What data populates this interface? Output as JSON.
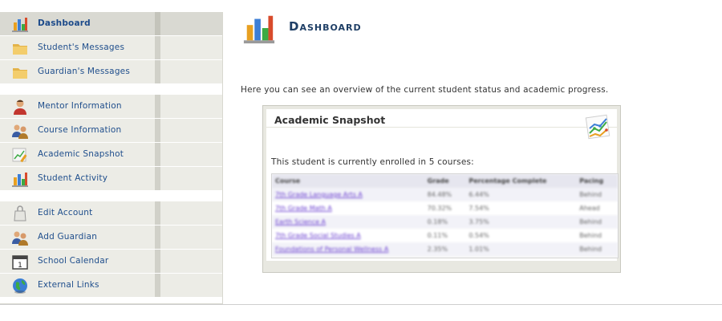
{
  "sidebar": {
    "groups": [
      [
        {
          "label": "Dashboard",
          "icon": "bar-chart-icon",
          "active": true
        },
        {
          "label": "Student's Messages",
          "icon": "folder-icon"
        },
        {
          "label": "Guardian's Messages",
          "icon": "folder-icon"
        }
      ],
      [
        {
          "label": "Mentor Information",
          "icon": "person-icon"
        },
        {
          "label": "Course Information",
          "icon": "people-icon"
        },
        {
          "label": "Academic Snapshot",
          "icon": "chart-pen-icon"
        },
        {
          "label": "Student Activity",
          "icon": "bar-chart-icon"
        }
      ],
      [
        {
          "label": "Edit Account",
          "icon": "bag-icon"
        },
        {
          "label": "Add Guardian",
          "icon": "people-icon"
        },
        {
          "label": "School Calendar",
          "icon": "calendar-icon"
        },
        {
          "label": "External Links",
          "icon": "globe-icon"
        }
      ]
    ]
  },
  "main": {
    "page_icon": "bar-chart-icon",
    "title": "Dashboard",
    "intro": "Here you can see an overview of the current student status and academic progress.",
    "snapshot": {
      "title": "Academic Snapshot",
      "icon": "line-chart-icon",
      "enrollment_text": "This student is currently enrolled in 5 courses:",
      "table": {
        "columns": [
          "Course",
          "Grade",
          "Percentage Complete",
          "Pacing"
        ],
        "rows": [
          {
            "course": "7th Grade Language Arts A",
            "grade": "84.48%",
            "complete": "6.44%",
            "pacing": "Behind"
          },
          {
            "course": "7th Grade Math A",
            "grade": "70.32%",
            "complete": "7.54%",
            "pacing": "Ahead"
          },
          {
            "course": "Earth Science A",
            "grade": "0.18%",
            "complete": "3.75%",
            "pacing": "Behind"
          },
          {
            "course": "7th Grade Social Studies A",
            "grade": "0.11%",
            "complete": "0.54%",
            "pacing": "Behind"
          },
          {
            "course": "Foundations of Personal Wellness A",
            "grade": "2.35%",
            "complete": "1.01%",
            "pacing": "Behind"
          }
        ]
      }
    }
  },
  "colors": {
    "nav_bg": "#ecece6",
    "nav_active_bg": "#d9d9d2",
    "link_blue": "#1f4e8c",
    "title_navy": "#1f3f66"
  }
}
